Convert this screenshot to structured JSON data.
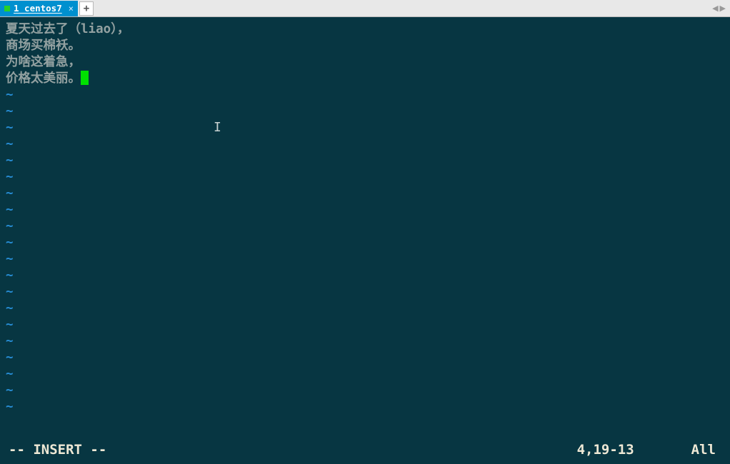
{
  "tab": {
    "label": "1 centos7",
    "close_glyph": "×"
  },
  "new_tab_glyph": "+",
  "nav": {
    "left": "◀",
    "right": "▶"
  },
  "editor": {
    "lines": [
      "夏天过去了（liao），",
      "商场买棉袄。",
      "为啥这着急，",
      "价格太美丽。"
    ],
    "tilde": "~",
    "tilde_count": 20
  },
  "mouse_cursor_glyph": "I",
  "status": {
    "mode": "-- INSERT --",
    "position": "4,19-13",
    "scroll": "All"
  }
}
